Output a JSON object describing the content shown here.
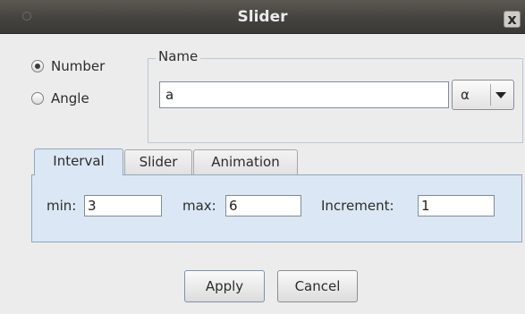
{
  "window": {
    "title": "Slider",
    "close_glyph": "x"
  },
  "type_options": [
    {
      "label": "Number",
      "checked": true
    },
    {
      "label": "Angle",
      "checked": false
    }
  ],
  "name_group": {
    "legend": "Name",
    "value": "a",
    "symbol_combo": {
      "selected": "α"
    }
  },
  "tabs": [
    "Interval",
    "Slider",
    "Animation"
  ],
  "active_tab": "Interval",
  "interval": {
    "min_label": "min:",
    "min_value": "3",
    "max_label": "max:",
    "max_value": "6",
    "increment_label": "Increment:",
    "increment_value": "1"
  },
  "buttons": {
    "apply": "Apply",
    "cancel": "Cancel"
  },
  "colors": {
    "titlebar": "#4a4845",
    "panel": "#ececec",
    "tab_active": "#dbe7f4",
    "group_border": "#b9c9d8"
  }
}
